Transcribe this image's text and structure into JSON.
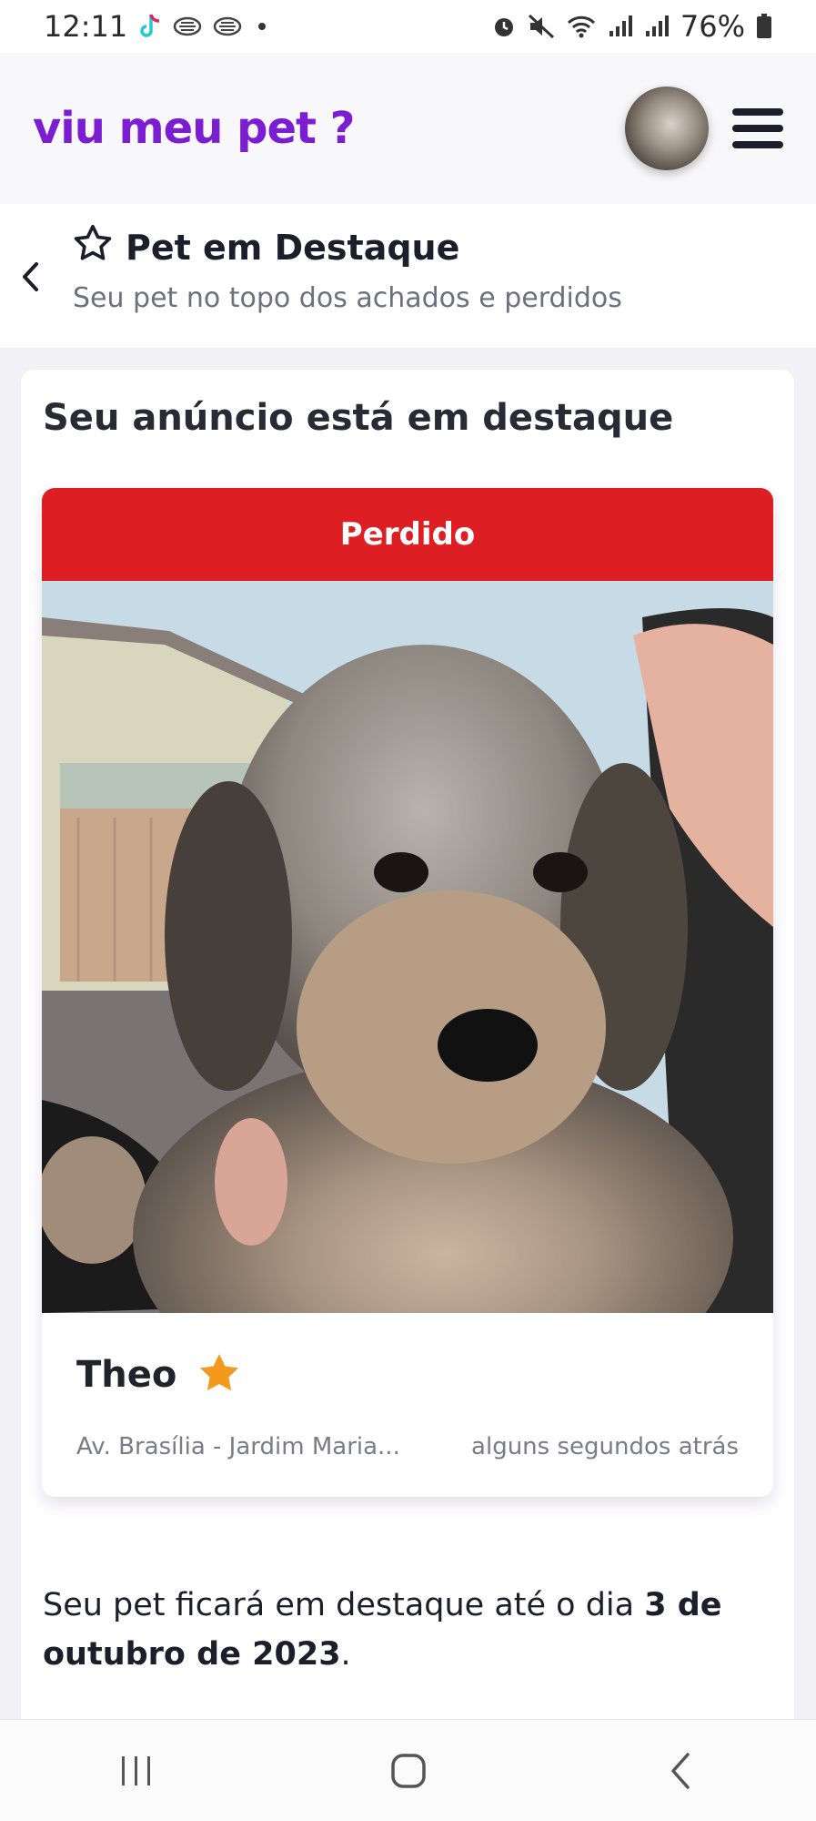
{
  "status_bar": {
    "time": "12:11",
    "battery": "76%",
    "icons": [
      "tiktok-icon",
      "notification-icon",
      "notification-icon",
      "alarm-icon",
      "mute-icon",
      "wifi-icon",
      "signal-icon",
      "signal-icon",
      "battery-icon"
    ]
  },
  "app": {
    "logo": "viu meu pet ?"
  },
  "page_header": {
    "title": "Pet em Destaque",
    "subtitle": "Seu pet no topo dos achados e perdidos"
  },
  "card": {
    "title": "Seu anúncio está em destaque",
    "pet": {
      "status": "Perdido",
      "name": "Theo",
      "location": "Av. Brasília - Jardim Maria...",
      "time": "alguns segundos atrás"
    },
    "notice": {
      "prefix": "Seu pet ficará em destaque até o dia ",
      "date": "3 de outubro de 2023",
      "suffix": "."
    }
  },
  "colors": {
    "brand": "#7b1ed1",
    "lost_banner": "#dd1f24",
    "star": "#f39a1e"
  }
}
